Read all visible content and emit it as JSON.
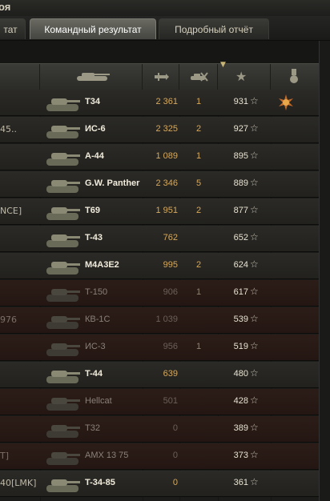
{
  "window": {
    "title": "оя"
  },
  "tabs": [
    {
      "label": "тат",
      "active": false
    },
    {
      "label": "Командный результат",
      "active": true
    },
    {
      "label": "Подробный отчёт",
      "active": false
    }
  ],
  "header": {
    "icons": [
      "tank-icon",
      "damage-icon",
      "kills-icon",
      "star-icon",
      "medal-icon"
    ],
    "sort_indicator": "chevron-down-icon"
  },
  "rows": [
    {
      "player": "",
      "tank": "T34",
      "damage": "2 361",
      "kills": "1",
      "xp": "931",
      "dead": false,
      "medal": true
    },
    {
      "player": "45..",
      "tank": "ИС-6",
      "damage": "2 325",
      "kills": "2",
      "xp": "927",
      "dead": false,
      "medal": false
    },
    {
      "player": "",
      "tank": "A-44",
      "damage": "1 089",
      "kills": "1",
      "xp": "895",
      "dead": false,
      "medal": false
    },
    {
      "player": "",
      "tank": "G.W. Panther",
      "damage": "2 346",
      "kills": "5",
      "xp": "889",
      "dead": false,
      "medal": false
    },
    {
      "player": "NCE]",
      "tank": "T69",
      "damage": "1 951",
      "kills": "2",
      "xp": "877",
      "dead": false,
      "medal": false
    },
    {
      "player": "",
      "tank": "T-43",
      "damage": "762",
      "kills": "",
      "xp": "652",
      "dead": false,
      "medal": false
    },
    {
      "player": "",
      "tank": "M4A3E2",
      "damage": "995",
      "kills": "2",
      "xp": "624",
      "dead": false,
      "medal": false
    },
    {
      "player": "",
      "tank": "T-150",
      "damage": "906",
      "kills": "1",
      "xp": "617",
      "dead": true,
      "medal": false
    },
    {
      "player": "976",
      "tank": "КВ-1С",
      "damage": "1 039",
      "kills": "",
      "xp": "539",
      "dead": true,
      "medal": false
    },
    {
      "player": "",
      "tank": "ИС-3",
      "damage": "956",
      "kills": "1",
      "xp": "519",
      "dead": true,
      "medal": false
    },
    {
      "player": "",
      "tank": "T-44",
      "damage": "639",
      "kills": "",
      "xp": "480",
      "dead": false,
      "medal": false
    },
    {
      "player": "",
      "tank": "Hellcat",
      "damage": "501",
      "kills": "",
      "xp": "428",
      "dead": true,
      "medal": false
    },
    {
      "player": "",
      "tank": "T32",
      "damage": "0",
      "kills": "",
      "xp": "389",
      "dead": true,
      "medal": false
    },
    {
      "player": "T]",
      "tank": "AMX 13 75",
      "damage": "0",
      "kills": "",
      "xp": "373",
      "dead": true,
      "medal": false
    },
    {
      "player": "40[LMK]",
      "tank": "T-34-85",
      "damage": "0",
      "kills": "",
      "xp": "361",
      "dead": false,
      "medal": false
    }
  ],
  "colors": {
    "damage": "#d7a95b",
    "dead_row": "#2c1d18",
    "alive_row": "#2b2a26"
  }
}
